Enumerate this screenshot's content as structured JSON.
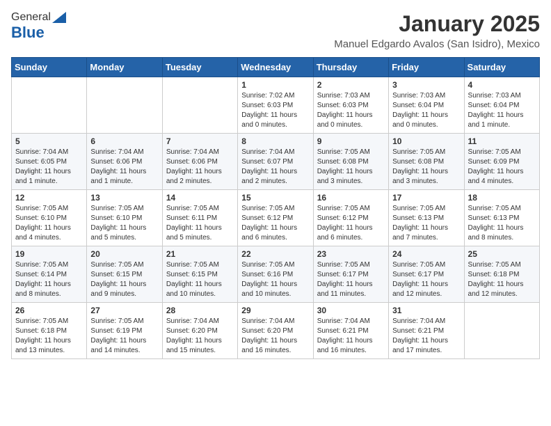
{
  "header": {
    "logo_general": "General",
    "logo_blue": "Blue",
    "title": "January 2025",
    "subtitle": "Manuel Edgardo Avalos (San Isidro), Mexico"
  },
  "weekdays": [
    "Sunday",
    "Monday",
    "Tuesday",
    "Wednesday",
    "Thursday",
    "Friday",
    "Saturday"
  ],
  "weeks": [
    [
      {
        "day": "",
        "info": ""
      },
      {
        "day": "",
        "info": ""
      },
      {
        "day": "",
        "info": ""
      },
      {
        "day": "1",
        "info": "Sunrise: 7:02 AM\nSunset: 6:03 PM\nDaylight: 11 hours\nand 0 minutes."
      },
      {
        "day": "2",
        "info": "Sunrise: 7:03 AM\nSunset: 6:03 PM\nDaylight: 11 hours\nand 0 minutes."
      },
      {
        "day": "3",
        "info": "Sunrise: 7:03 AM\nSunset: 6:04 PM\nDaylight: 11 hours\nand 0 minutes."
      },
      {
        "day": "4",
        "info": "Sunrise: 7:03 AM\nSunset: 6:04 PM\nDaylight: 11 hours\nand 1 minute."
      }
    ],
    [
      {
        "day": "5",
        "info": "Sunrise: 7:04 AM\nSunset: 6:05 PM\nDaylight: 11 hours\nand 1 minute."
      },
      {
        "day": "6",
        "info": "Sunrise: 7:04 AM\nSunset: 6:06 PM\nDaylight: 11 hours\nand 1 minute."
      },
      {
        "day": "7",
        "info": "Sunrise: 7:04 AM\nSunset: 6:06 PM\nDaylight: 11 hours\nand 2 minutes."
      },
      {
        "day": "8",
        "info": "Sunrise: 7:04 AM\nSunset: 6:07 PM\nDaylight: 11 hours\nand 2 minutes."
      },
      {
        "day": "9",
        "info": "Sunrise: 7:05 AM\nSunset: 6:08 PM\nDaylight: 11 hours\nand 3 minutes."
      },
      {
        "day": "10",
        "info": "Sunrise: 7:05 AM\nSunset: 6:08 PM\nDaylight: 11 hours\nand 3 minutes."
      },
      {
        "day": "11",
        "info": "Sunrise: 7:05 AM\nSunset: 6:09 PM\nDaylight: 11 hours\nand 4 minutes."
      }
    ],
    [
      {
        "day": "12",
        "info": "Sunrise: 7:05 AM\nSunset: 6:10 PM\nDaylight: 11 hours\nand 4 minutes."
      },
      {
        "day": "13",
        "info": "Sunrise: 7:05 AM\nSunset: 6:10 PM\nDaylight: 11 hours\nand 5 minutes."
      },
      {
        "day": "14",
        "info": "Sunrise: 7:05 AM\nSunset: 6:11 PM\nDaylight: 11 hours\nand 5 minutes."
      },
      {
        "day": "15",
        "info": "Sunrise: 7:05 AM\nSunset: 6:12 PM\nDaylight: 11 hours\nand 6 minutes."
      },
      {
        "day": "16",
        "info": "Sunrise: 7:05 AM\nSunset: 6:12 PM\nDaylight: 11 hours\nand 6 minutes."
      },
      {
        "day": "17",
        "info": "Sunrise: 7:05 AM\nSunset: 6:13 PM\nDaylight: 11 hours\nand 7 minutes."
      },
      {
        "day": "18",
        "info": "Sunrise: 7:05 AM\nSunset: 6:13 PM\nDaylight: 11 hours\nand 8 minutes."
      }
    ],
    [
      {
        "day": "19",
        "info": "Sunrise: 7:05 AM\nSunset: 6:14 PM\nDaylight: 11 hours\nand 8 minutes."
      },
      {
        "day": "20",
        "info": "Sunrise: 7:05 AM\nSunset: 6:15 PM\nDaylight: 11 hours\nand 9 minutes."
      },
      {
        "day": "21",
        "info": "Sunrise: 7:05 AM\nSunset: 6:15 PM\nDaylight: 11 hours\nand 10 minutes."
      },
      {
        "day": "22",
        "info": "Sunrise: 7:05 AM\nSunset: 6:16 PM\nDaylight: 11 hours\nand 10 minutes."
      },
      {
        "day": "23",
        "info": "Sunrise: 7:05 AM\nSunset: 6:17 PM\nDaylight: 11 hours\nand 11 minutes."
      },
      {
        "day": "24",
        "info": "Sunrise: 7:05 AM\nSunset: 6:17 PM\nDaylight: 11 hours\nand 12 minutes."
      },
      {
        "day": "25",
        "info": "Sunrise: 7:05 AM\nSunset: 6:18 PM\nDaylight: 11 hours\nand 12 minutes."
      }
    ],
    [
      {
        "day": "26",
        "info": "Sunrise: 7:05 AM\nSunset: 6:18 PM\nDaylight: 11 hours\nand 13 minutes."
      },
      {
        "day": "27",
        "info": "Sunrise: 7:05 AM\nSunset: 6:19 PM\nDaylight: 11 hours\nand 14 minutes."
      },
      {
        "day": "28",
        "info": "Sunrise: 7:04 AM\nSunset: 6:20 PM\nDaylight: 11 hours\nand 15 minutes."
      },
      {
        "day": "29",
        "info": "Sunrise: 7:04 AM\nSunset: 6:20 PM\nDaylight: 11 hours\nand 16 minutes."
      },
      {
        "day": "30",
        "info": "Sunrise: 7:04 AM\nSunset: 6:21 PM\nDaylight: 11 hours\nand 16 minutes."
      },
      {
        "day": "31",
        "info": "Sunrise: 7:04 AM\nSunset: 6:21 PM\nDaylight: 11 hours\nand 17 minutes."
      },
      {
        "day": "",
        "info": ""
      }
    ]
  ]
}
